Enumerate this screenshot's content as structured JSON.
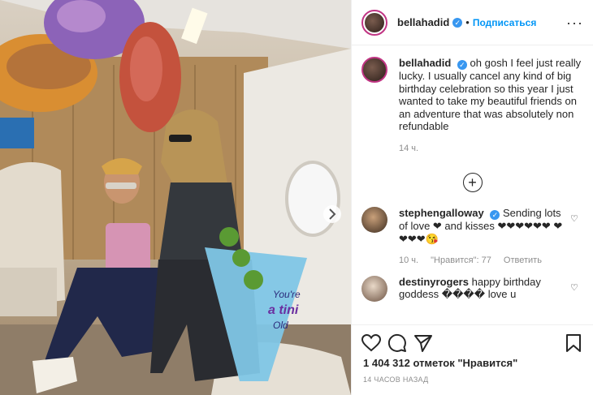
{
  "post": {
    "username": "bellahadid",
    "follow_label": "Подписаться",
    "caption": "oh gosh I feel just really lucky. I usually cancel any kind of big birthday celebration so this year I just wanted to take my beautiful friends on an adventure that was absolutely non refundable",
    "caption_time": "14 ч.",
    "likes": "1 404 312 отметок \"Нравится\"",
    "timestamp": "14 ЧАСОВ НАЗАД",
    "balloon_text_line1": "You're",
    "balloon_text_line2": "a tini",
    "balloon_text_line3": "Old"
  },
  "comments": [
    {
      "username": "stephengalloway",
      "text": "Sending lots of love ❤ and kisses ❤❤❤❤❤❤ ❤❤❤❤😘",
      "time": "10 ч.",
      "likes": "\"Нравится\": 77",
      "reply": "Ответить"
    },
    {
      "username": "destinyrogers",
      "text": "happy birthday goddess ���� love u"
    }
  ],
  "colors": {
    "accent": "#0095f6",
    "verified": "#3897f0"
  },
  "icons": [
    "heart-icon",
    "comment-icon",
    "share-icon",
    "bookmark-icon",
    "more-icon",
    "plus-circle-icon",
    "verified-icon"
  ]
}
